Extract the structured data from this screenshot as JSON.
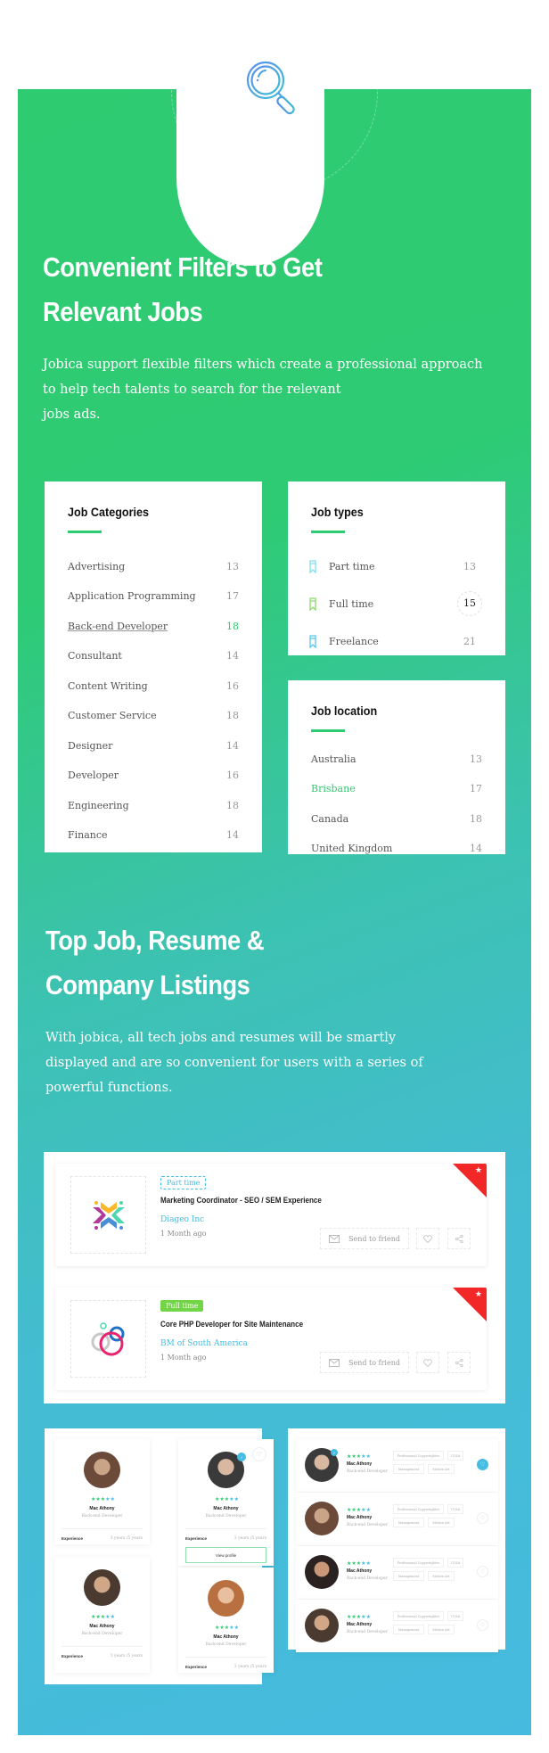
{
  "hero_icon": "search-icon",
  "section1": {
    "title_line1": "Convenient Filters to Get",
    "title_line2": "Relevant Jobs",
    "desc_line1": "Jobica support flexible filters which create a professional approach",
    "desc_line2": "to help tech talents to search for the relevant",
    "desc_line3": "jobs ads."
  },
  "job_categories": {
    "title": "Job Categories",
    "items": [
      {
        "label": "Advertising",
        "count": "13"
      },
      {
        "label": "Application Programming",
        "count": "17"
      },
      {
        "label": "Back-end Developer",
        "count": "18",
        "active": true
      },
      {
        "label": "Consultant",
        "count": "14"
      },
      {
        "label": "Content Writing",
        "count": "16"
      },
      {
        "label": "Customer Service",
        "count": "18"
      },
      {
        "label": "Designer",
        "count": "14"
      },
      {
        "label": "Developer",
        "count": "16"
      },
      {
        "label": "Engineering",
        "count": "18"
      },
      {
        "label": "Finance",
        "count": "14"
      }
    ]
  },
  "job_types": {
    "title": "Job types",
    "items": [
      {
        "label": "Part time",
        "count": "13",
        "color": "#7fe0f0",
        "icon": "bookmark-icon"
      },
      {
        "label": "Full time",
        "count": "15",
        "color": "#8ed96a",
        "icon": "bookmark-icon",
        "highlighted": true
      },
      {
        "label": "Freelance",
        "count": "21",
        "color": "#55c6f0",
        "icon": "bookmark-icon"
      }
    ]
  },
  "job_location": {
    "title": "Job location",
    "items": [
      {
        "label": "Australia",
        "count": "13"
      },
      {
        "label": "Brisbane",
        "count": "17",
        "active": true
      },
      {
        "label": "Canada",
        "count": "18"
      },
      {
        "label": "United Kingdom",
        "count": "14"
      }
    ]
  },
  "section2": {
    "title_line1": "Top Job, Resume &",
    "title_line2": "Company Listings",
    "desc_line1": "With jobica, all tech jobs and resumes will be smartly",
    "desc_line2": "displayed and are so convenient for users with a series of",
    "desc_line3": "powerful functions."
  },
  "jobs": [
    {
      "type": "Part time",
      "title": "Marketing Coordinator - SEO / SEM Experience",
      "company": "Diageo Inc",
      "posted": "1 Month ago",
      "send_label": "Send to friend",
      "featured": true
    },
    {
      "type": "Full time",
      "title": "Core PHP Developer for Site Maintenance",
      "company": "BM of South America",
      "posted": "1 Month ago",
      "send_label": "Send to friend",
      "featured": true
    }
  ],
  "candidates_grid": [
    {
      "name": "Mac Athony",
      "role": "Back-end Developer",
      "exp_label": "Experience",
      "exp_value": "3 years /5 years",
      "rating": 5
    },
    {
      "name": "Mac Athony",
      "role": "Back-end Developer",
      "exp_label": "Experience",
      "exp_value": "3 years /5 years",
      "rating": 5,
      "verified": true,
      "view_label": "View profile"
    },
    {
      "name": "Mac Athony",
      "role": "Back-end Developer",
      "exp_label": "Experience",
      "exp_value": "3 years /5 years",
      "rating": 5
    },
    {
      "name": "Mac Athony",
      "role": "Back-end Developer",
      "exp_label": "Experience",
      "exp_value": "3 years /5 years",
      "rating": 5
    }
  ],
  "candidates_list": [
    {
      "name": "Mac Athony",
      "role": "Back-end Developer",
      "rating": 5,
      "verified": true,
      "favorited": true,
      "tags": [
        "Professional Copywrighter",
        "UI Kit",
        "Management",
        "Motion Art"
      ]
    },
    {
      "name": "Mac Athony",
      "role": "Back-end Developer",
      "rating": 5,
      "tags": [
        "Professional Copywrighter",
        "UI Kit",
        "Management",
        "Motion Art"
      ]
    },
    {
      "name": "Mac Athony",
      "role": "Back-end Developer",
      "rating": 5,
      "tags": [
        "Professional Copywrighter",
        "UI Kit",
        "Management",
        "Motion Art"
      ]
    },
    {
      "name": "Mac Athony",
      "role": "Back-end Developer",
      "rating": 5,
      "tags": [
        "Professional Copywrighter",
        "UI Kit",
        "Management",
        "Motion Art"
      ]
    }
  ],
  "colors": {
    "green": "#2ecb71",
    "blue": "#45bde3",
    "red": "#f22828",
    "badge_green": "#72d548"
  }
}
